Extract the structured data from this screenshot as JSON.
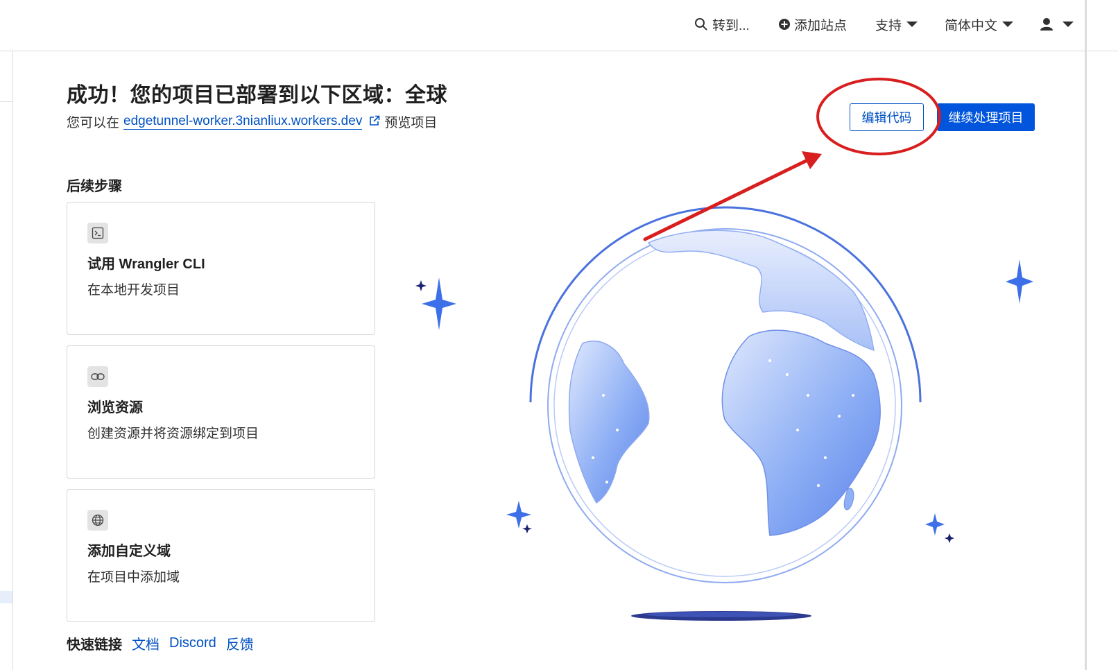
{
  "nav": {
    "search_label": "转到...",
    "add_site_label": "添加站点",
    "support_label": "支持",
    "language_label": "简体中文"
  },
  "header": {
    "title": "成功！您的项目已部署到以下区域：全球",
    "preview_prefix": "您可以在",
    "preview_link": "edgetunnel-worker.3nianliux.workers.dev",
    "preview_suffix": "预览项目"
  },
  "actions": {
    "edit_code": "编辑代码",
    "continue": "继续处理项目"
  },
  "next_steps": {
    "title": "后续步骤",
    "cards": [
      {
        "icon": "terminal-icon",
        "title": "试用 Wrangler CLI",
        "desc": "在本地开发项目"
      },
      {
        "icon": "link-icon",
        "title": "浏览资源",
        "desc": "创建资源并将资源绑定到项目"
      },
      {
        "icon": "globe-icon",
        "title": "添加自定义域",
        "desc": "在项目中添加域"
      }
    ]
  },
  "quick_links": {
    "title": "快速链接",
    "items": [
      "文档",
      "Discord",
      "反馈"
    ]
  },
  "colors": {
    "accent": "#0051c3",
    "primary_button": "#0055dc",
    "annotation": "#d81e1e",
    "globe": "#4a78e6"
  }
}
